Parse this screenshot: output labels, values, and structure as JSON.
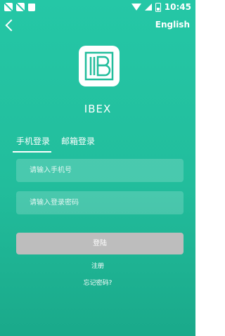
{
  "status_bar": {
    "time": "10:45"
  },
  "header": {
    "language": "English"
  },
  "app": {
    "name": "IBEX"
  },
  "tabs": [
    {
      "label": "手机登录",
      "active": true
    },
    {
      "label": "邮箱登录",
      "active": false
    }
  ],
  "form": {
    "phone_placeholder": "请输入手机号",
    "password_placeholder": "请输入登录密码",
    "login_label": "登陆",
    "register_label": "注册",
    "forgot_label": "忘记密码?"
  },
  "colors": {
    "background": "#22bd9c",
    "button_disabled": "#bdbdbd"
  }
}
